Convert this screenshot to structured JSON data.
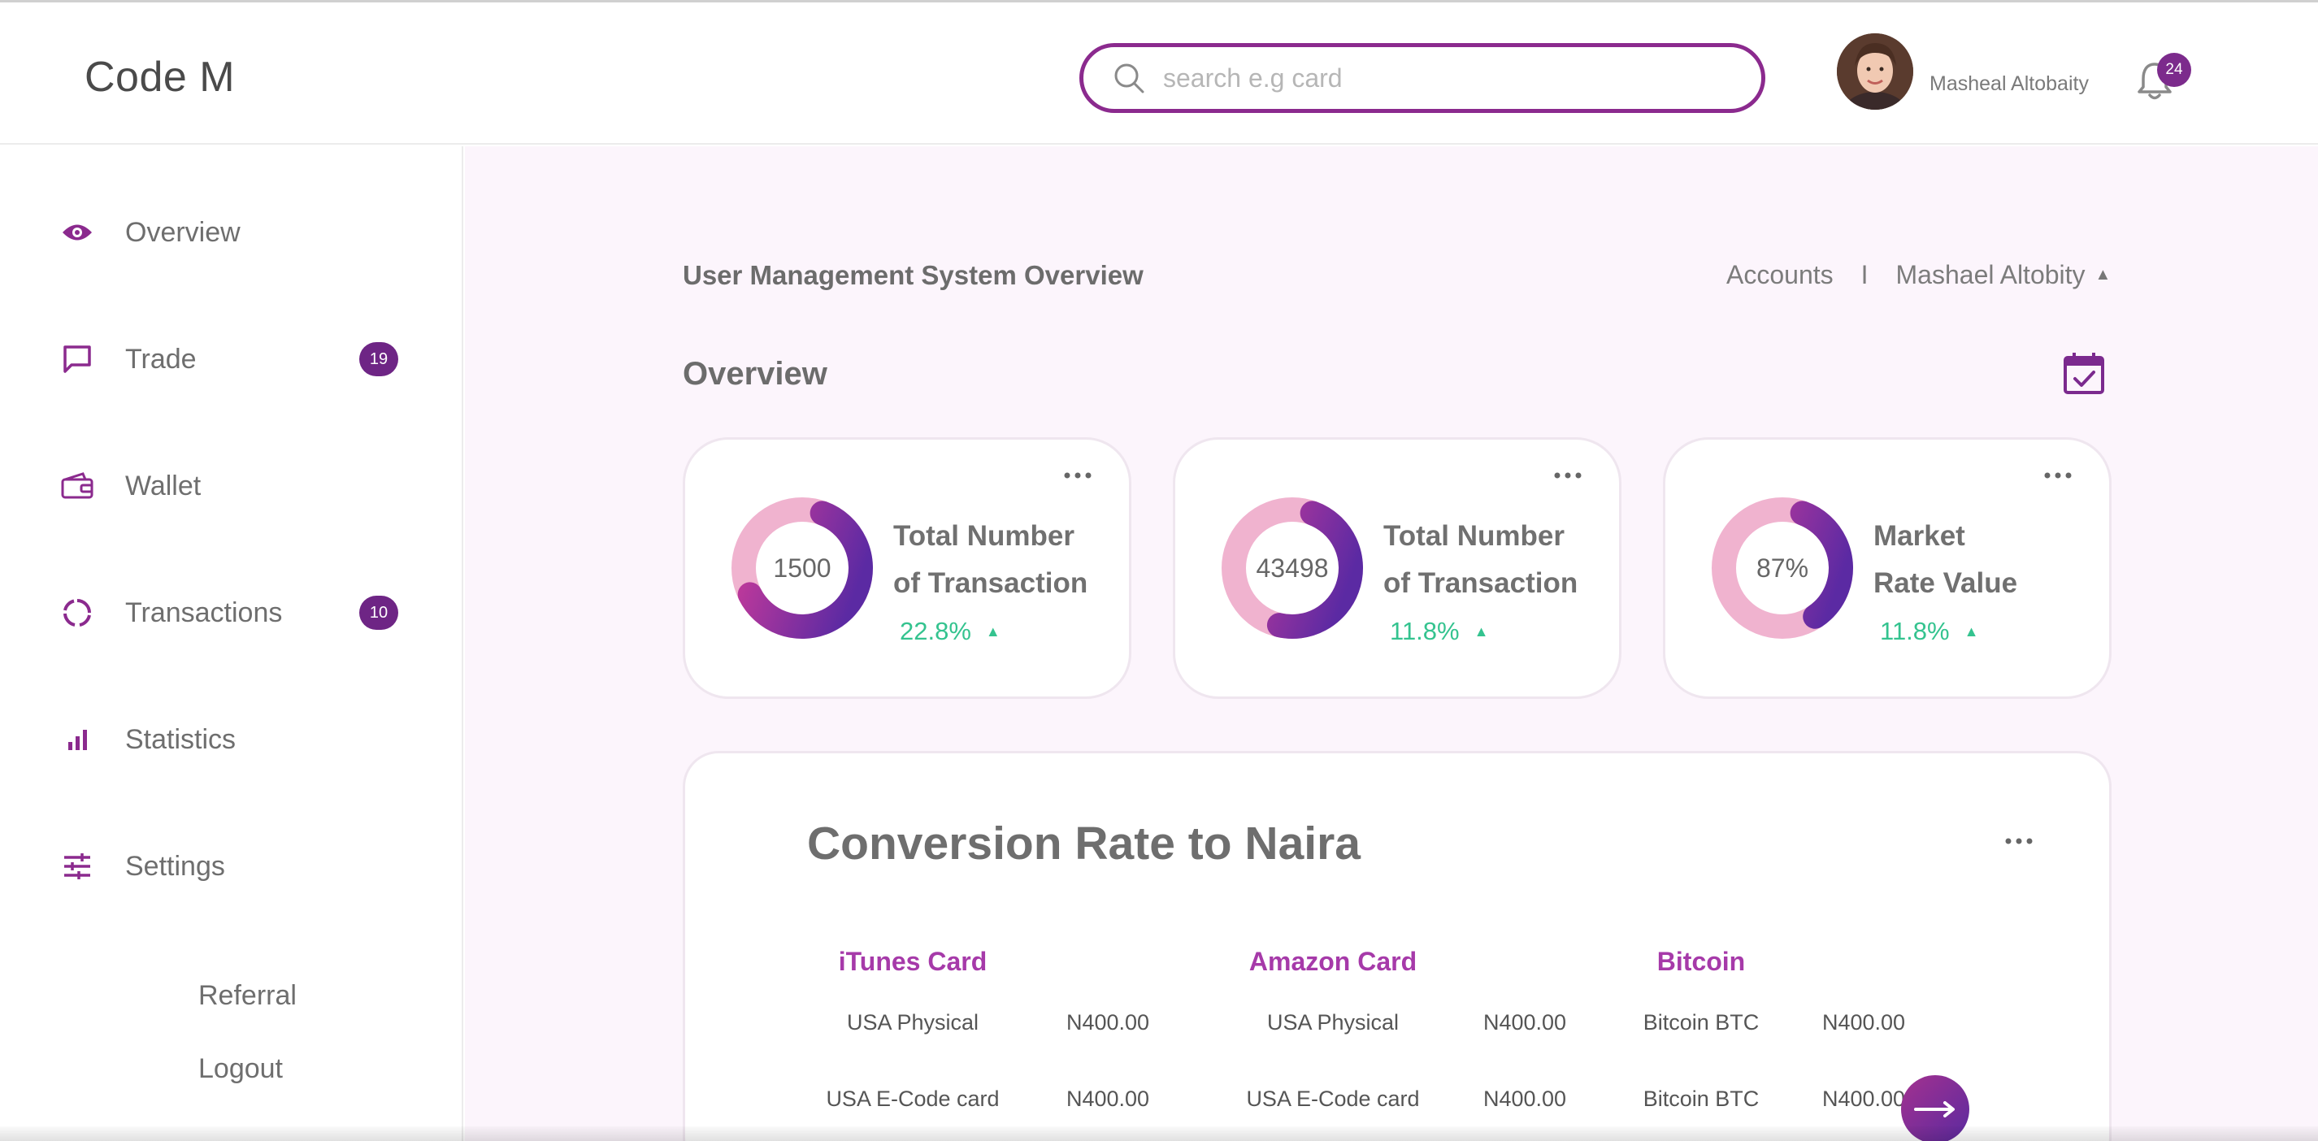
{
  "brand": "Code M",
  "search": {
    "placeholder": "search e.g card",
    "value": ""
  },
  "user": {
    "name": "Masheal Altobaity"
  },
  "notifications": {
    "count": "24"
  },
  "sidebar": {
    "items": [
      {
        "label": "Overview",
        "icon": "eye-icon"
      },
      {
        "label": "Trade",
        "icon": "chat-icon",
        "badge": "19"
      },
      {
        "label": "Wallet",
        "icon": "wallet-icon"
      },
      {
        "label": "Transactions",
        "icon": "circle-progress-icon",
        "badge": "10"
      },
      {
        "label": "Statistics",
        "icon": "bar-chart-icon"
      },
      {
        "label": "Settings",
        "icon": "sliders-icon"
      }
    ],
    "links": [
      "Referral",
      "Logout"
    ]
  },
  "main": {
    "title": "User Management System Overview",
    "breadcrumb": {
      "first": "Accounts",
      "separator": "I",
      "second": "Mashael Altobity"
    },
    "section_title": "Overview",
    "stats": [
      {
        "value": "1500",
        "label_line1": "Total Number",
        "label_line2": "of Transaction",
        "change": "22.8%",
        "progress": 0.62
      },
      {
        "value": "43498",
        "label_line1": "Total Number",
        "label_line2": "of Transaction",
        "change": "11.8%",
        "progress": 0.48
      },
      {
        "value": "87%",
        "label_line1": "Market",
        "label_line2": "Rate Value",
        "change": "11.8%",
        "progress": 0.35
      }
    ],
    "conversion": {
      "title": "Conversion Rate to Naira",
      "columns": [
        {
          "heading": "iTunes Card",
          "rows": [
            {
              "name": "USA Physical",
              "rate": "N400.00"
            },
            {
              "name": "USA E-Code card",
              "rate": "N400.00"
            }
          ]
        },
        {
          "heading": "Amazon Card",
          "rows": [
            {
              "name": "USA Physical",
              "rate": "N400.00"
            },
            {
              "name": "USA E-Code card",
              "rate": "N400.00"
            }
          ]
        },
        {
          "heading": "Bitcoin",
          "rows": [
            {
              "name": "Bitcoin BTC",
              "rate": "N400.00"
            },
            {
              "name": "Bitcoin BTC",
              "rate": "N400.00"
            }
          ]
        }
      ]
    }
  },
  "colors": {
    "accent": "#8b2a8e",
    "badge": "#6e2585",
    "positive": "#34c38f",
    "donut_light": "#f0b3cf",
    "main_bg": "#fcf5fc"
  }
}
